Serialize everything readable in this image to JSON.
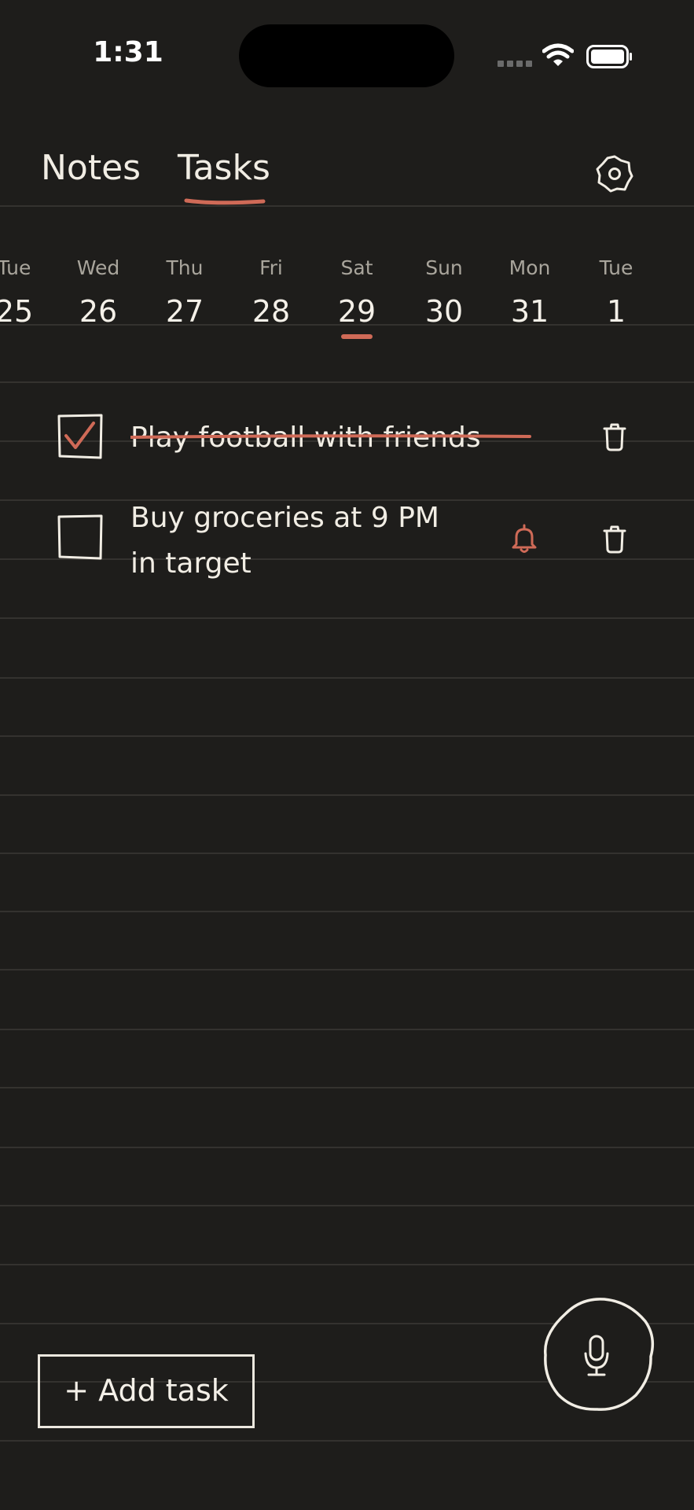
{
  "status_bar": {
    "time": "1:31"
  },
  "tabs": {
    "notes": "Notes",
    "tasks": "Tasks",
    "active": "Tasks"
  },
  "calendar": {
    "days": [
      {
        "dow": "Tue",
        "num": "25"
      },
      {
        "dow": "Wed",
        "num": "26"
      },
      {
        "dow": "Thu",
        "num": "27"
      },
      {
        "dow": "Fri",
        "num": "28"
      },
      {
        "dow": "Sat",
        "num": "29"
      },
      {
        "dow": "Sun",
        "num": "30"
      },
      {
        "dow": "Mon",
        "num": "31"
      },
      {
        "dow": "Tue",
        "num": "1"
      }
    ],
    "selected": "29"
  },
  "tasks": [
    {
      "text": "Play football with friends",
      "done": true,
      "reminder": false
    },
    {
      "text": "Buy groceries at 9 PM in target",
      "done": false,
      "reminder": true
    }
  ],
  "actions": {
    "add_task": "+ Add task"
  },
  "icons": {
    "settings": "gear-icon",
    "delete": "trash-icon",
    "reminder": "bell-icon",
    "voice": "microphone-icon"
  },
  "colors": {
    "background": "#1e1d1b",
    "accent": "#cf6a57",
    "text": "#f1ede4",
    "rule_line": "#34322f"
  }
}
